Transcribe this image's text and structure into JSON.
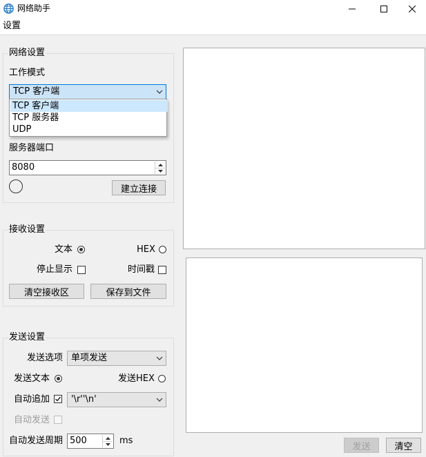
{
  "window": {
    "title": "网络助手"
  },
  "menu": {
    "settings": "设置"
  },
  "network": {
    "group_title": "网络设置",
    "mode_label": "工作模式",
    "mode_selected": "TCP 客户端",
    "mode_options": [
      "TCP 客户端",
      "TCP 服务器",
      "UDP"
    ],
    "port_label": "服务器端口",
    "port_value": "8080",
    "connect_button": "建立连接"
  },
  "receive": {
    "group_title": "接收设置",
    "text_label": "文本",
    "hex_label": "HEX",
    "stop_display_label": "停止显示",
    "timestamp_label": "时间戳",
    "clear_button": "清空接收区",
    "save_button": "保存到文件"
  },
  "send": {
    "group_title": "发送设置",
    "option_label": "发送选项",
    "option_value": "单项发送",
    "send_text_label": "发送文本",
    "send_hex_label": "发送HEX",
    "auto_append_label": "自动追加",
    "append_value": "'\\r''\\n'",
    "auto_send_label": "自动发送",
    "period_label": "自动发送周期",
    "period_value": "500",
    "period_unit": "ms",
    "send_button": "发送",
    "clear_button": "清空"
  }
}
